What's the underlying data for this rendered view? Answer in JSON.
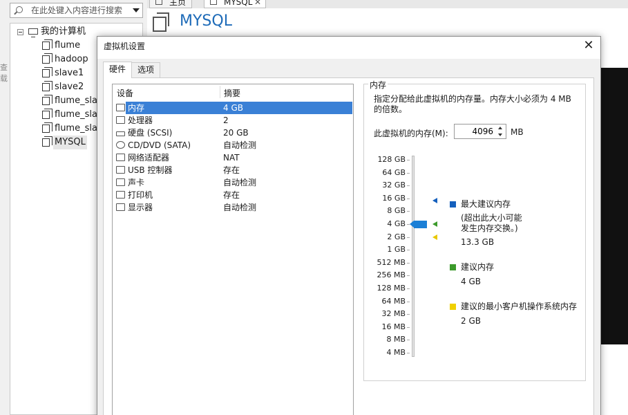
{
  "search": {
    "placeholder": "在此处键入内容进行搜索"
  },
  "library": {
    "root": "我的计算机",
    "vms": [
      "flume",
      "hadoop",
      "slave1",
      "slave2",
      "flume_slave",
      "flume_slave",
      "flume_slave",
      "MYSQL"
    ],
    "selected_index": 7
  },
  "side_text": [
    "查",
    "载"
  ],
  "tabs": [
    "主页",
    "MYSQL"
  ],
  "vm": {
    "title": "MYSQL"
  },
  "dialog": {
    "title": "虚拟机设置",
    "close": "✕",
    "tabs": [
      "硬件",
      "选项"
    ],
    "table": {
      "headers": [
        "设备",
        "摘要"
      ],
      "rows": [
        {
          "device": "内存",
          "summary": "4 GB",
          "icon": "memory-icon"
        },
        {
          "device": "处理器",
          "summary": "2",
          "icon": "cpu-icon"
        },
        {
          "device": "硬盘 (SCSI)",
          "summary": "20 GB",
          "icon": "disk-icon"
        },
        {
          "device": "CD/DVD (SATA)",
          "summary": "自动检测",
          "icon": "cd-icon"
        },
        {
          "device": "网络适配器",
          "summary": "NAT",
          "icon": "network-icon"
        },
        {
          "device": "USB 控制器",
          "summary": "存在",
          "icon": "usb-icon"
        },
        {
          "device": "声卡",
          "summary": "自动检测",
          "icon": "sound-icon"
        },
        {
          "device": "打印机",
          "summary": "存在",
          "icon": "printer-icon"
        },
        {
          "device": "显示器",
          "summary": "自动检测",
          "icon": "display-icon"
        }
      ],
      "selected_index": 0
    },
    "memory": {
      "group_title": "内存",
      "description": "指定分配给此虚拟机的内存量。内存大小必须为 4 MB 的倍数。",
      "label": "此虚拟机的内存(M):",
      "value": "4096",
      "unit": "MB",
      "scale_labels": [
        "128 GB",
        "64 GB",
        "32 GB",
        "16 GB",
        "8 GB",
        "4 GB",
        "2 GB",
        "1 GB",
        "512 MB",
        "256 MB",
        "128 MB",
        "64 MB",
        "32 MB",
        "16 MB",
        "8 MB",
        "4 MB"
      ],
      "slider_index": 5,
      "markers": [
        {
          "index": 3.15,
          "color": "#1560bd"
        },
        {
          "index": 5.0,
          "color": "#3c9a2b"
        },
        {
          "index": 6.0,
          "color": "#e8c800"
        }
      ],
      "legend": {
        "max_title": "最大建议内存",
        "max_note_1": "(超出此大小可能",
        "max_note_2": "发生内存交换。)",
        "max_value": "13.3 GB",
        "rec_title": "建议内存",
        "rec_value": "4 GB",
        "min_title": "建议的最小客户机操作系统内存",
        "min_value": "2 GB"
      },
      "colors": {
        "max": "#1560bd",
        "rec": "#3c9a2b",
        "min": "#f0d000",
        "slider": "#1b7fd6"
      }
    }
  }
}
